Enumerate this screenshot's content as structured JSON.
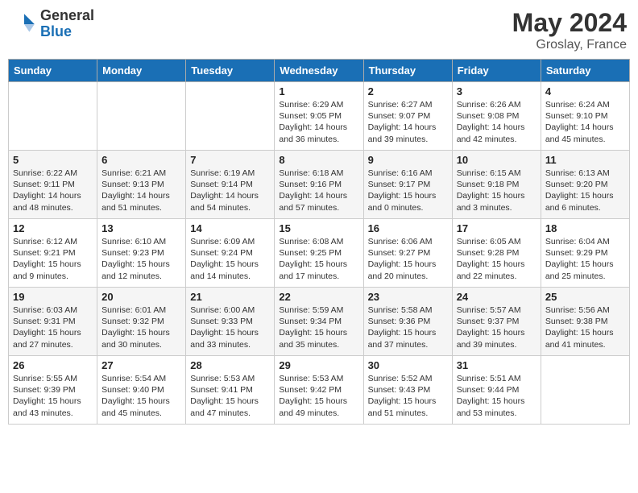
{
  "header": {
    "logo_general": "General",
    "logo_blue": "Blue",
    "month_title": "May 2024",
    "location": "Groslay, France"
  },
  "days_of_week": [
    "Sunday",
    "Monday",
    "Tuesday",
    "Wednesday",
    "Thursday",
    "Friday",
    "Saturday"
  ],
  "weeks": [
    [
      {
        "day": "",
        "info": ""
      },
      {
        "day": "",
        "info": ""
      },
      {
        "day": "",
        "info": ""
      },
      {
        "day": "1",
        "info": "Sunrise: 6:29 AM\nSunset: 9:05 PM\nDaylight: 14 hours\nand 36 minutes."
      },
      {
        "day": "2",
        "info": "Sunrise: 6:27 AM\nSunset: 9:07 PM\nDaylight: 14 hours\nand 39 minutes."
      },
      {
        "day": "3",
        "info": "Sunrise: 6:26 AM\nSunset: 9:08 PM\nDaylight: 14 hours\nand 42 minutes."
      },
      {
        "day": "4",
        "info": "Sunrise: 6:24 AM\nSunset: 9:10 PM\nDaylight: 14 hours\nand 45 minutes."
      }
    ],
    [
      {
        "day": "5",
        "info": "Sunrise: 6:22 AM\nSunset: 9:11 PM\nDaylight: 14 hours\nand 48 minutes."
      },
      {
        "day": "6",
        "info": "Sunrise: 6:21 AM\nSunset: 9:13 PM\nDaylight: 14 hours\nand 51 minutes."
      },
      {
        "day": "7",
        "info": "Sunrise: 6:19 AM\nSunset: 9:14 PM\nDaylight: 14 hours\nand 54 minutes."
      },
      {
        "day": "8",
        "info": "Sunrise: 6:18 AM\nSunset: 9:16 PM\nDaylight: 14 hours\nand 57 minutes."
      },
      {
        "day": "9",
        "info": "Sunrise: 6:16 AM\nSunset: 9:17 PM\nDaylight: 15 hours\nand 0 minutes."
      },
      {
        "day": "10",
        "info": "Sunrise: 6:15 AM\nSunset: 9:18 PM\nDaylight: 15 hours\nand 3 minutes."
      },
      {
        "day": "11",
        "info": "Sunrise: 6:13 AM\nSunset: 9:20 PM\nDaylight: 15 hours\nand 6 minutes."
      }
    ],
    [
      {
        "day": "12",
        "info": "Sunrise: 6:12 AM\nSunset: 9:21 PM\nDaylight: 15 hours\nand 9 minutes."
      },
      {
        "day": "13",
        "info": "Sunrise: 6:10 AM\nSunset: 9:23 PM\nDaylight: 15 hours\nand 12 minutes."
      },
      {
        "day": "14",
        "info": "Sunrise: 6:09 AM\nSunset: 9:24 PM\nDaylight: 15 hours\nand 14 minutes."
      },
      {
        "day": "15",
        "info": "Sunrise: 6:08 AM\nSunset: 9:25 PM\nDaylight: 15 hours\nand 17 minutes."
      },
      {
        "day": "16",
        "info": "Sunrise: 6:06 AM\nSunset: 9:27 PM\nDaylight: 15 hours\nand 20 minutes."
      },
      {
        "day": "17",
        "info": "Sunrise: 6:05 AM\nSunset: 9:28 PM\nDaylight: 15 hours\nand 22 minutes."
      },
      {
        "day": "18",
        "info": "Sunrise: 6:04 AM\nSunset: 9:29 PM\nDaylight: 15 hours\nand 25 minutes."
      }
    ],
    [
      {
        "day": "19",
        "info": "Sunrise: 6:03 AM\nSunset: 9:31 PM\nDaylight: 15 hours\nand 27 minutes."
      },
      {
        "day": "20",
        "info": "Sunrise: 6:01 AM\nSunset: 9:32 PM\nDaylight: 15 hours\nand 30 minutes."
      },
      {
        "day": "21",
        "info": "Sunrise: 6:00 AM\nSunset: 9:33 PM\nDaylight: 15 hours\nand 33 minutes."
      },
      {
        "day": "22",
        "info": "Sunrise: 5:59 AM\nSunset: 9:34 PM\nDaylight: 15 hours\nand 35 minutes."
      },
      {
        "day": "23",
        "info": "Sunrise: 5:58 AM\nSunset: 9:36 PM\nDaylight: 15 hours\nand 37 minutes."
      },
      {
        "day": "24",
        "info": "Sunrise: 5:57 AM\nSunset: 9:37 PM\nDaylight: 15 hours\nand 39 minutes."
      },
      {
        "day": "25",
        "info": "Sunrise: 5:56 AM\nSunset: 9:38 PM\nDaylight: 15 hours\nand 41 minutes."
      }
    ],
    [
      {
        "day": "26",
        "info": "Sunrise: 5:55 AM\nSunset: 9:39 PM\nDaylight: 15 hours\nand 43 minutes."
      },
      {
        "day": "27",
        "info": "Sunrise: 5:54 AM\nSunset: 9:40 PM\nDaylight: 15 hours\nand 45 minutes."
      },
      {
        "day": "28",
        "info": "Sunrise: 5:53 AM\nSunset: 9:41 PM\nDaylight: 15 hours\nand 47 minutes."
      },
      {
        "day": "29",
        "info": "Sunrise: 5:53 AM\nSunset: 9:42 PM\nDaylight: 15 hours\nand 49 minutes."
      },
      {
        "day": "30",
        "info": "Sunrise: 5:52 AM\nSunset: 9:43 PM\nDaylight: 15 hours\nand 51 minutes."
      },
      {
        "day": "31",
        "info": "Sunrise: 5:51 AM\nSunset: 9:44 PM\nDaylight: 15 hours\nand 53 minutes."
      },
      {
        "day": "",
        "info": ""
      }
    ]
  ]
}
